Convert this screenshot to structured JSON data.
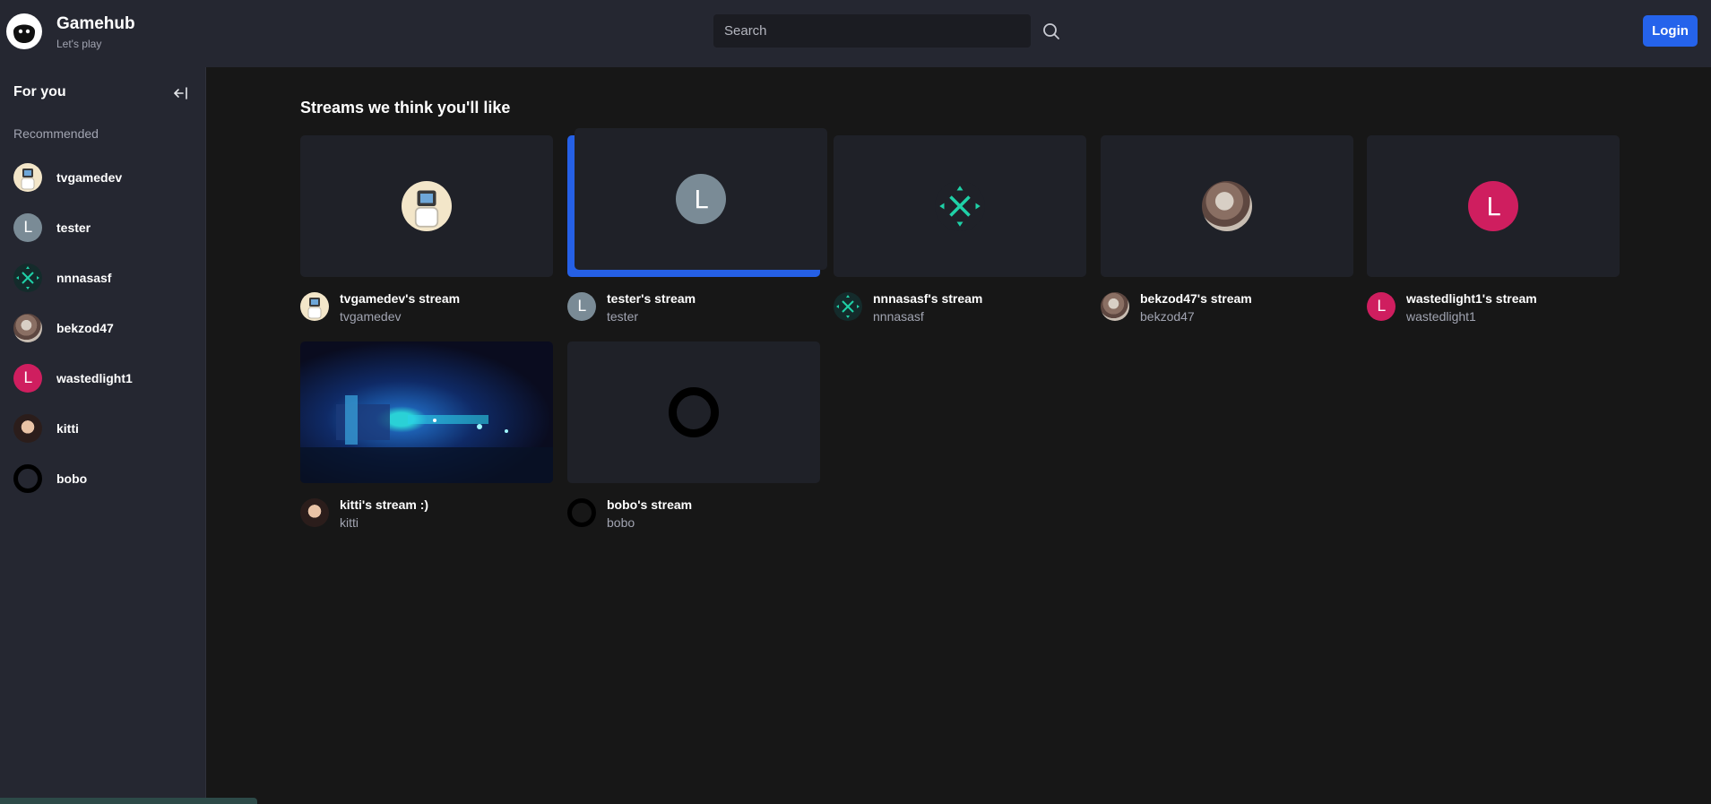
{
  "header": {
    "brand_title": "Gamehub",
    "brand_subtitle": "Let's play",
    "search_placeholder": "Search",
    "search_value": "",
    "login_label": "Login"
  },
  "sidebar": {
    "heading": "For you",
    "section_label": "Recommended",
    "items": [
      {
        "label": "tvgamedev",
        "avatar": "tv-avatar"
      },
      {
        "label": "tester",
        "avatar": "letter",
        "letter": "L"
      },
      {
        "label": "nnnasasf",
        "avatar": "knives-avatar"
      },
      {
        "label": "bekzod47",
        "avatar": "cowboy-avatar"
      },
      {
        "label": "wastedlight1",
        "avatar": "letter",
        "letter": "L"
      },
      {
        "label": "kitti",
        "avatar": "woman-avatar"
      },
      {
        "label": "bobo",
        "avatar": "ring-avatar"
      }
    ]
  },
  "main": {
    "title": "Streams we think you'll like",
    "streams": [
      {
        "title": "tvgamedev's stream",
        "user": "tvgamedev"
      },
      {
        "title": "tester's stream",
        "user": "tester",
        "letter": "L"
      },
      {
        "title": "nnnasasf's stream",
        "user": "nnnasasf"
      },
      {
        "title": "bekzod47's stream",
        "user": "bekzod47"
      },
      {
        "title": "wastedlight1's stream",
        "user": "wastedlight1",
        "letter": "L"
      },
      {
        "title": "kitti's stream :)",
        "user": "kitti"
      },
      {
        "title": "bobo's stream",
        "user": "bobo"
      }
    ]
  },
  "colors": {
    "header_bg": "#252731",
    "page_bg": "#171717",
    "accent": "#2563eb",
    "muted_text": "#a1a4b1",
    "avatar_gray": "#7a8b96",
    "avatar_pink": "#cf1e5f"
  }
}
